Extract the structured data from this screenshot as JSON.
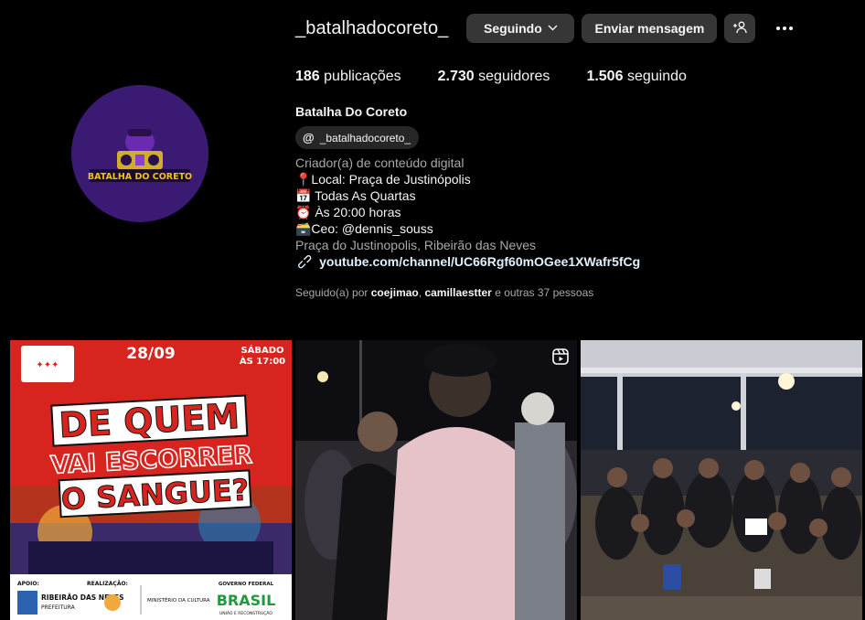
{
  "profile": {
    "username": "_batalhadocoreto_",
    "full_name": "Batalha Do Coreto",
    "threads_handle": "_batalhadocoreto_",
    "avatar_text": "BATALHA DO CORETO"
  },
  "actions": {
    "following_label": "Seguindo",
    "message_label": "Enviar mensagem"
  },
  "stats": {
    "posts_count": "186",
    "posts_label": "publicações",
    "followers_count": "2.730",
    "followers_label": "seguidores",
    "following_count": "1.506",
    "following_label": "seguindo"
  },
  "bio": {
    "category": "Criador(a) de conteúdo digital",
    "line1": "📍Local: Praça de Justinópolis",
    "line2": "📅 Todas As Quartas",
    "line3": "⏰ Às 20:00 horas",
    "line4": "🗃️Ceo: @dennis_souss",
    "address": "Praça do Justinopolis, Ribeirão das Neves",
    "link": "youtube.com/channel/UC66Rgf60mOGee1XWafr5fCg"
  },
  "followed_by": {
    "prefix": "Seguido(a) por",
    "user1": "coejimao",
    "sep": ",",
    "user2": "camillaestter",
    "suffix": "e outras 37 pessoas"
  },
  "posts": [
    {
      "date": "28/09",
      "day": "SÁBADO",
      "time": "ÀS 17:00",
      "headline1": "DE QUEM",
      "headline2": "VAI ESCORRER",
      "headline3": "O SANGUE?",
      "support_label": "APOIO:",
      "sponsor_label": "REALIZAÇÃO:",
      "city": "RIBEIRÃO DAS NEVES",
      "city_sub": "PREFEITURA",
      "ministry": "MINISTÉRIO DA CULTURA",
      "gov": "GOVERNO FEDERAL",
      "brasil": "BRASIL",
      "gov_sub": "UNIÃO E RECONSTRUÇÃO"
    },
    {
      "type": "reel"
    },
    {
      "type": "photo"
    }
  ],
  "colors": {
    "button_bg": "#363636",
    "muted_text": "#a8a8a8",
    "link_text": "#e0f1ff",
    "avatar_bg": "#3a1a73",
    "poster_red": "#d8241f"
  }
}
